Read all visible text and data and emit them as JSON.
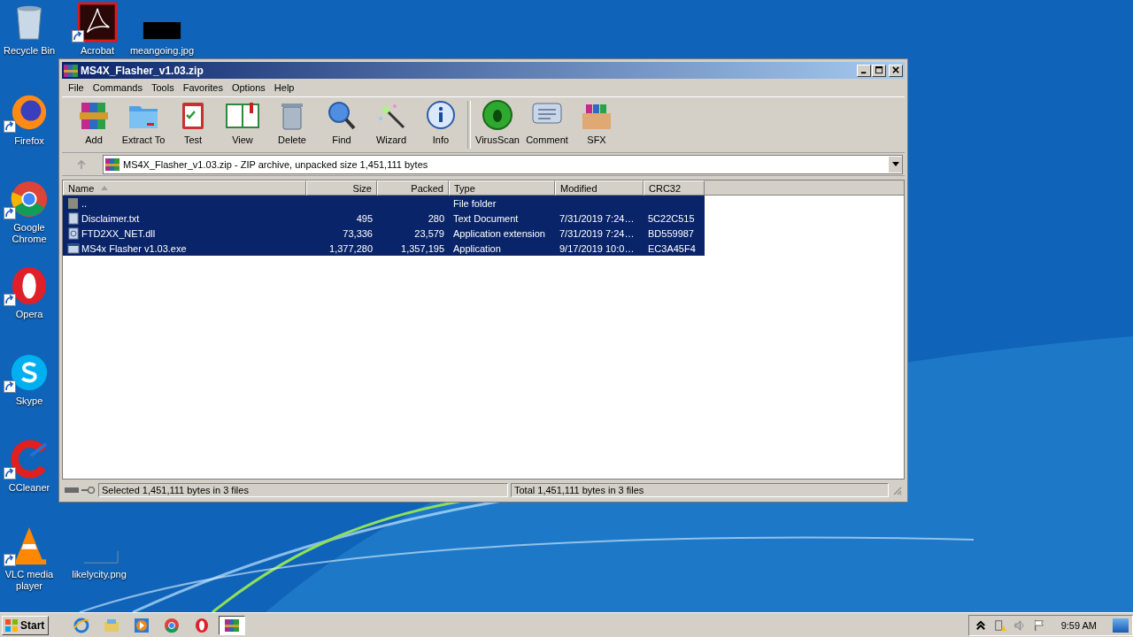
{
  "desktop_icons": [
    {
      "label": "Recycle Bin",
      "kind": "recycle",
      "shortcut": false
    },
    {
      "label": "Acrobat",
      "kind": "acrobat",
      "shortcut": true
    },
    {
      "label": "meangoing.jpg",
      "kind": "image-dark",
      "shortcut": false
    },
    {
      "label": "Firefox",
      "kind": "firefox",
      "shortcut": true
    },
    {
      "label": "Google Chrome",
      "kind": "chrome",
      "shortcut": true
    },
    {
      "label": "Opera",
      "kind": "opera",
      "shortcut": true
    },
    {
      "label": "Skype",
      "kind": "skype",
      "shortcut": true
    },
    {
      "label": "CCleaner",
      "kind": "ccleaner",
      "shortcut": true
    },
    {
      "label": "VLC media player",
      "kind": "vlc",
      "shortcut": true
    },
    {
      "label": "likelycity.png",
      "kind": "image-blank",
      "shortcut": false
    }
  ],
  "window": {
    "title": "MS4X_Flasher_v1.03.zip",
    "menu": [
      "File",
      "Commands",
      "Tools",
      "Favorites",
      "Options",
      "Help"
    ],
    "toolbar": [
      {
        "label": "Add",
        "kind": "add",
        "separator_before": false
      },
      {
        "label": "Extract To",
        "kind": "extract",
        "separator_before": false
      },
      {
        "label": "Test",
        "kind": "test",
        "separator_before": false
      },
      {
        "label": "View",
        "kind": "view",
        "separator_before": false
      },
      {
        "label": "Delete",
        "kind": "delete",
        "separator_before": false
      },
      {
        "label": "Find",
        "kind": "find",
        "separator_before": false
      },
      {
        "label": "Wizard",
        "kind": "wizard",
        "separator_before": false
      },
      {
        "label": "Info",
        "kind": "info",
        "separator_before": false
      },
      {
        "label": "VirusScan",
        "kind": "virusscan",
        "separator_before": true
      },
      {
        "label": "Comment",
        "kind": "comment",
        "separator_before": false
      },
      {
        "label": "SFX",
        "kind": "sfx",
        "separator_before": false
      }
    ],
    "address": "MS4X_Flasher_v1.03.zip - ZIP archive, unpacked size 1,451,111 bytes",
    "columns": [
      {
        "label": "Name",
        "sorted": true
      },
      {
        "label": "Size",
        "sorted": false
      },
      {
        "label": "Packed",
        "sorted": false
      },
      {
        "label": "Type",
        "sorted": false
      },
      {
        "label": "Modified",
        "sorted": false
      },
      {
        "label": "CRC32",
        "sorted": false
      }
    ],
    "rows": [
      {
        "kind": "folder",
        "selected": true,
        "cells": [
          "..",
          "",
          "",
          "File folder",
          "",
          ""
        ]
      },
      {
        "kind": "text",
        "selected": true,
        "cells": [
          "Disclaimer.txt",
          "495",
          "280",
          "Text Document",
          "7/31/2019 7:24…",
          "5C22C515"
        ]
      },
      {
        "kind": "dll",
        "selected": true,
        "cells": [
          "FTD2XX_NET.dll",
          "73,336",
          "23,579",
          "Application extension",
          "7/31/2019 7:24…",
          "BD559987"
        ]
      },
      {
        "kind": "exe",
        "selected": true,
        "cells": [
          "MS4x Flasher v1.03.exe",
          "1,377,280",
          "1,357,195",
          "Application",
          "9/17/2019 10:0…",
          "EC3A45F4"
        ]
      }
    ],
    "status_left": "Selected 1,451,111 bytes in 3 files",
    "status_right": "Total 1,451,111 bytes in 3 files"
  },
  "taskbar": {
    "start": "Start",
    "items": [
      {
        "kind": "ie",
        "selected": false
      },
      {
        "kind": "explorer",
        "selected": false
      },
      {
        "kind": "media",
        "selected": false
      },
      {
        "kind": "chrome",
        "selected": false
      },
      {
        "kind": "opera",
        "selected": false
      },
      {
        "kind": "winrar",
        "selected": true
      }
    ],
    "clock": "9:59 AM"
  }
}
